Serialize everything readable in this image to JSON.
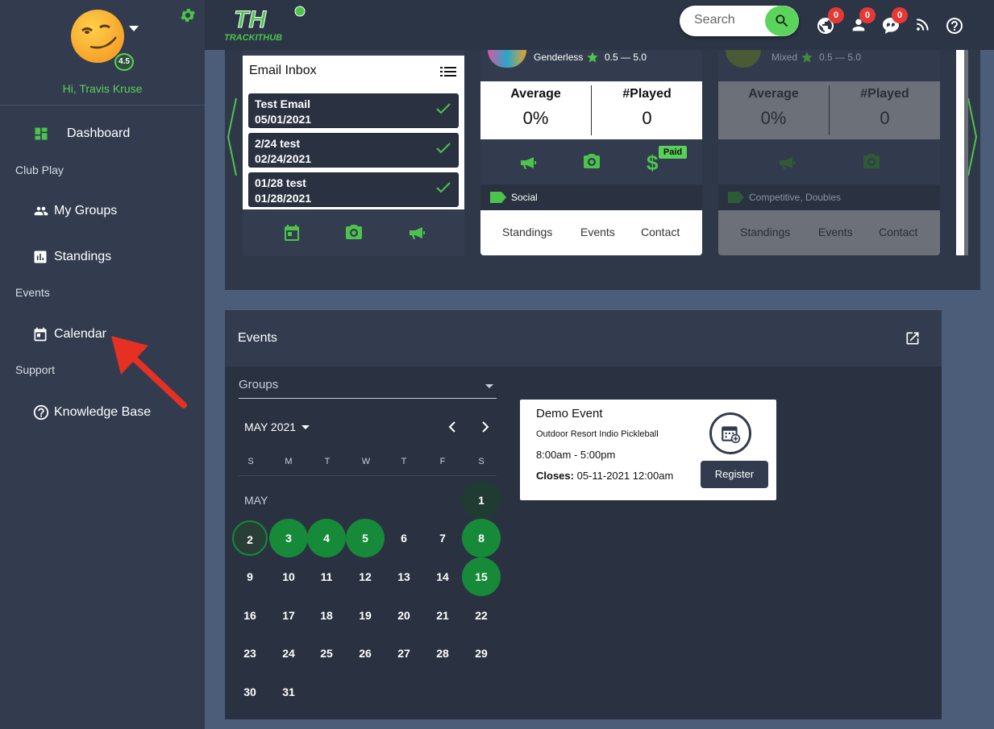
{
  "user": {
    "greeting": "Hi, Travis Kruse",
    "rating": "4.5"
  },
  "nav": {
    "dashboard": "Dashboard",
    "section_club_play": "Club Play",
    "my_groups": "My Groups",
    "standings": "Standings",
    "section_events": "Events",
    "calendar": "Calendar",
    "section_support": "Support",
    "knowledge_base": "Knowledge Base"
  },
  "topbar": {
    "logo_text": "TRACKITHUB",
    "search_placeholder": "Search",
    "badges": {
      "globe": "0",
      "user": "0",
      "chat": "0"
    }
  },
  "inbox": {
    "title": "Email Inbox",
    "items": [
      {
        "subject": "Test Email",
        "date": "05/01/2021"
      },
      {
        "subject": "2/24 test",
        "date": "02/24/2021"
      },
      {
        "subject": "01/28 test",
        "date": "01/28/2021"
      }
    ]
  },
  "group_cards": [
    {
      "gender": "Genderless",
      "range": "0.5 — 5.0",
      "avg_label": "Average",
      "avg": "0%",
      "played_label": "#Played",
      "played": "0",
      "paid": "Paid",
      "tag": "Social",
      "links": [
        "Standings",
        "Events",
        "Contact"
      ]
    },
    {
      "gender": "Mixed",
      "range": "0.5 — 5.0",
      "avg_label": "Average",
      "avg": "0%",
      "played_label": "#Played",
      "played": "0",
      "tag": "Competitive, Doubles",
      "links": [
        "Standings",
        "Events",
        "Contact"
      ]
    }
  ],
  "events": {
    "title": "Events",
    "groups_select": "Groups",
    "month_label": "MAY 2021",
    "month_short": "MAY",
    "weekdays": [
      "S",
      "M",
      "T",
      "W",
      "T",
      "F",
      "S"
    ],
    "days": [
      "1",
      "2",
      "3",
      "4",
      "5",
      "6",
      "7",
      "8",
      "9",
      "10",
      "11",
      "12",
      "13",
      "14",
      "15",
      "16",
      "17",
      "18",
      "19",
      "20",
      "21",
      "22",
      "23",
      "24",
      "25",
      "26",
      "27",
      "28",
      "29",
      "30",
      "31"
    ],
    "event": {
      "name": "Demo Event",
      "location": "Outdoor Resort Indio Pickleball",
      "time": "8:00am - 5:00pm",
      "closes_label": "Closes:",
      "closes_value": "05-11-2021 12:00am",
      "register": "Register"
    }
  },
  "colors": {
    "accent": "#5ad05a",
    "event_day": "#178a3a",
    "sidebar": "#323c4e",
    "badge": "#e53935"
  }
}
